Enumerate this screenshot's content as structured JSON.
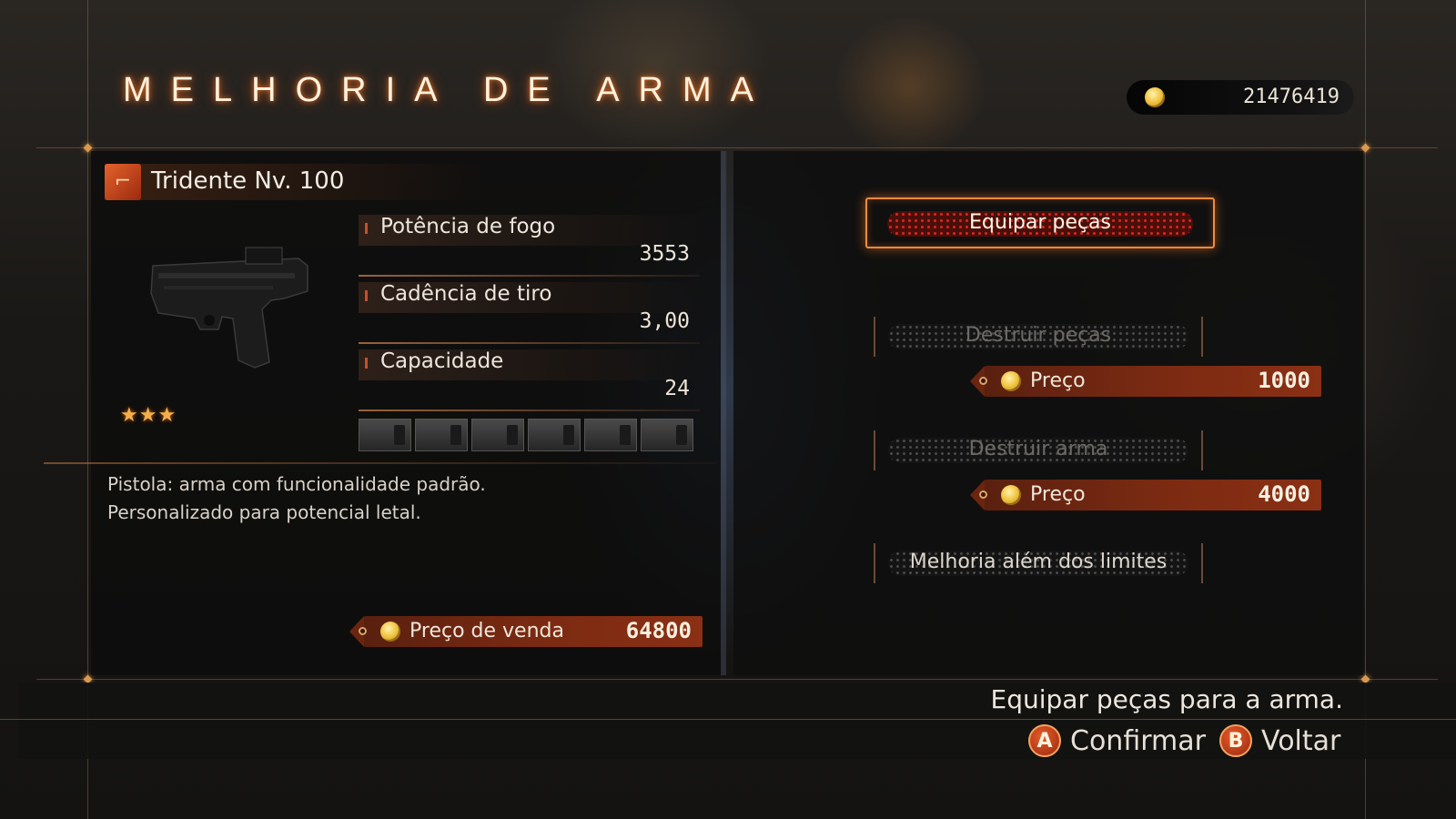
{
  "header": {
    "title": "MELHORIA DE ARMA",
    "money": "21476419",
    "money_icon": "coin-icon"
  },
  "weapon": {
    "icon": "pistol-icon",
    "name": "Tridente Nv. 100",
    "stars": "★★★",
    "rating": 3,
    "stats": [
      {
        "label": "Potência de fogo",
        "value": "3553"
      },
      {
        "label": "Cadência de tiro",
        "value": "3,00"
      },
      {
        "label": "Capacidade",
        "value": "24"
      }
    ],
    "part_slots": 6,
    "description": [
      "Pistola: arma com funcionalidade padrão.",
      "Personalizado para potencial letal."
    ],
    "sell_price_label": "Preço de venda",
    "sell_price": "64800"
  },
  "menu": {
    "equip": "Equipar peças",
    "destroy_parts": "Destruir peças",
    "destroy_parts_price_label": "Preço",
    "destroy_parts_price": "1000",
    "destroy_weapon": "Destruir arma",
    "destroy_weapon_price_label": "Preço",
    "destroy_weapon_price": "4000",
    "limit_break": "Melhoria além dos limites"
  },
  "footer": {
    "hint": "Equipar peças para a arma.",
    "confirm_button": "A",
    "confirm_label": "Confirmar",
    "back_button": "B",
    "back_label": "Voltar"
  },
  "colors": {
    "accent": "#f28a3c",
    "price_tag": "#7a2a12",
    "active_button": "#4a0f0a"
  }
}
